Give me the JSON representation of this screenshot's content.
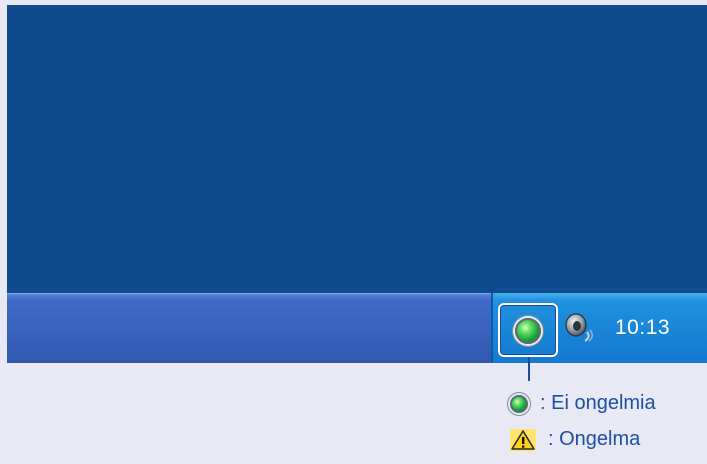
{
  "taskbar": {
    "clock": "10:13",
    "tray_icons": [
      "status-ok-icon",
      "speaker-icon"
    ]
  },
  "legend": {
    "ok": {
      "icon": "green-status-icon",
      "text": ": Ei ongelmia"
    },
    "problem": {
      "icon": "warning-icon",
      "text": ": Ongelma"
    }
  },
  "colors": {
    "desktop": "#0f4b8d",
    "taskbar": "#3f6bc6",
    "tray": "#1f91de",
    "legend_text": "#1d4fa3",
    "status_ok": "#1ea83a",
    "warning": "#ffd21a"
  }
}
